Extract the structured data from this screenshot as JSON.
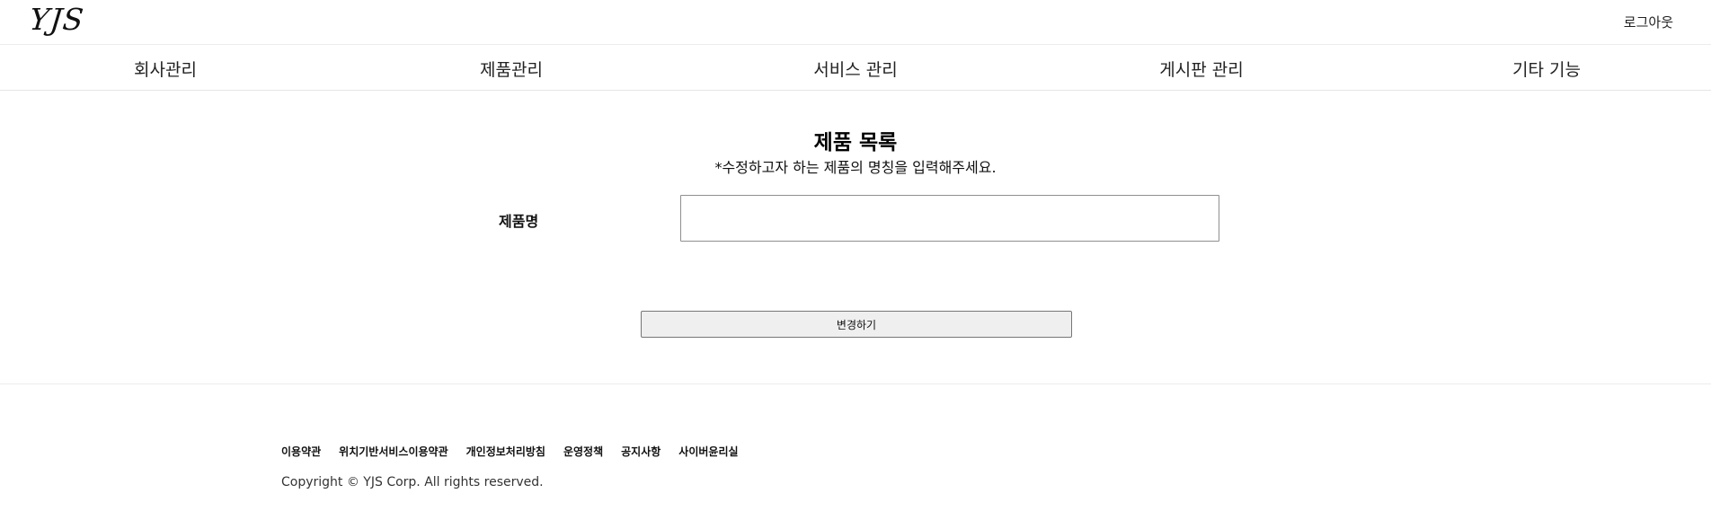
{
  "header": {
    "logo_text": "YJS",
    "logout_label": "로그아웃"
  },
  "nav": {
    "items": [
      {
        "label": "회사관리"
      },
      {
        "label": "제품관리"
      },
      {
        "label": "서비스 관리"
      },
      {
        "label": "게시판 관리"
      },
      {
        "label": "기타 기능"
      }
    ]
  },
  "main": {
    "title": "제품 목록",
    "subtitle": "*수정하고자 하는 제품의 명칭을 입력해주세요.",
    "field_label": "제품명",
    "field_value": "",
    "submit_label": "변경하기"
  },
  "footer": {
    "links": [
      {
        "label": "이용약관"
      },
      {
        "label": "위치기반서비스이용약관"
      },
      {
        "label": "개인정보처리방침"
      },
      {
        "label": "운영정책"
      },
      {
        "label": "공지사항"
      },
      {
        "label": "사이버윤리실"
      }
    ],
    "copyright": "Copyright © YJS Corp. All rights reserved."
  }
}
